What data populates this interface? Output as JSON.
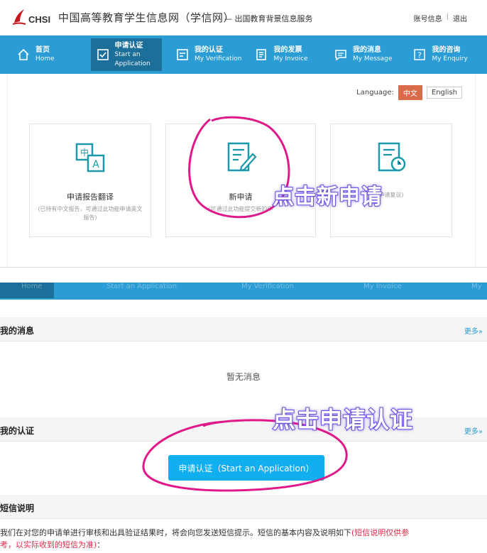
{
  "header": {
    "logo_text": "CHSI",
    "site_title": "中国高等教育学生信息网（学信网）",
    "site_sub": "— 出国教育背景信息服务",
    "account_label": "账号信息",
    "logout_label": "退出"
  },
  "nav": [
    {
      "zh": "首页",
      "en": "Home",
      "icon": "home-icon"
    },
    {
      "zh": "申请认证",
      "en": "Start an Application",
      "icon": "apply-icon"
    },
    {
      "zh": "我的认证",
      "en": "My Verification",
      "icon": "verification-icon"
    },
    {
      "zh": "我的发票",
      "en": "My Invoice",
      "icon": "invoice-icon"
    },
    {
      "zh": "我的消息",
      "en": "My Message",
      "icon": "message-icon"
    },
    {
      "zh": "我的咨询",
      "en": "My Enquiry",
      "icon": "enquiry-icon"
    }
  ],
  "language": {
    "label": "Language:",
    "zh": "中文",
    "en": "English",
    "active_color": "#d96b4a"
  },
  "cards": [
    {
      "title": "申请报告翻译",
      "desc": "(已持有中文报告，可通过此功能申请英文报告)",
      "icon": "translate-icon"
    },
    {
      "title": "新申请",
      "desc": "(可通过此功能提交新的申",
      "icon": "new-application-icon"
    },
    {
      "title": "",
      "desc": "申请复议)",
      "icon": "review-icon"
    }
  ],
  "overlays": {
    "click_new": "点击新申请",
    "click_apply": "点击申请认证"
  },
  "strip_ghost": [
    "Home",
    "Start an Application",
    "My Verification",
    "My Invoice",
    "My"
  ],
  "messages": {
    "title": "我的消息",
    "more": "更多»",
    "empty": "暂无消息"
  },
  "verification": {
    "title": "我的认证",
    "more": "更多»",
    "button": "申请认证（Start an Application）"
  },
  "sms": {
    "title": "短信说明",
    "line1": "我们在对您的申请单进行审核和出具验证结果时，将会向您发送短信提示。短信的基本内容及说明如下",
    "line1_red": "(短信说明仅供参",
    "line2_red": "考，以实际收到的短信为准)",
    "line2_end": "："
  },
  "colors": {
    "nav_bg": "#2b9cd4",
    "nav_active": "#1b6f98",
    "button": "#11aef0",
    "annotation": "#e0198a",
    "overlay": "#6c4fe0"
  }
}
